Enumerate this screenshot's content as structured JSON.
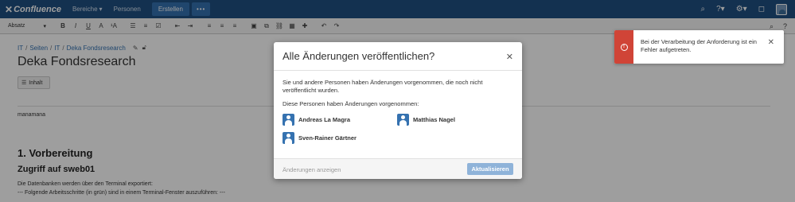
{
  "topnav": {
    "logo_text": "Confluence",
    "items": [
      {
        "label": "Bereiche"
      },
      {
        "label": "Personen"
      }
    ],
    "create_label": "Erstellen",
    "more_label": "•••"
  },
  "toolbar": {
    "paragraph_label": "Absatz",
    "bold": "B",
    "italic": "I",
    "underline": "U",
    "text_color": "A",
    "more_format": "¹A"
  },
  "breadcrumb": [
    "IT",
    "Seiten",
    "IT",
    "Deka Fondsresearch"
  ],
  "page": {
    "title": "Deka Fondsresearch",
    "toc_button": "Inhalt",
    "text1": "manamana",
    "h1": "1. Vorbereitung",
    "h2": "Zugriff auf sweb01",
    "p1": "Die Datenbanken werden über den Terminal exportiert:",
    "p2": "--- Folgende Arbeitsschritte (in grün) sind in einem Terminal-Fenster auszuführen: ---"
  },
  "modal": {
    "title": "Alle Änderungen veröffentlichen?",
    "description": "Sie und andere Personen haben Änderungen vorgenommen, die noch nicht veröffentlicht wurden.",
    "people_heading": "Diese Personen haben Änderungen vorgenommen:",
    "people": [
      {
        "name": "Andreas La Magra"
      },
      {
        "name": "Matthias Nagel"
      },
      {
        "name": "Sven-Rainer Gärtner"
      }
    ],
    "show_changes_link": "Änderungen anzeigen",
    "update_button": "Aktualisieren"
  },
  "error_flag": {
    "message": "Bei der Verarbeitung der Anforderung ist ein Fehler aufgetreten."
  },
  "colors": {
    "nav_bg": "#205081",
    "error_red": "#d04437",
    "link_blue": "#3572b0"
  }
}
